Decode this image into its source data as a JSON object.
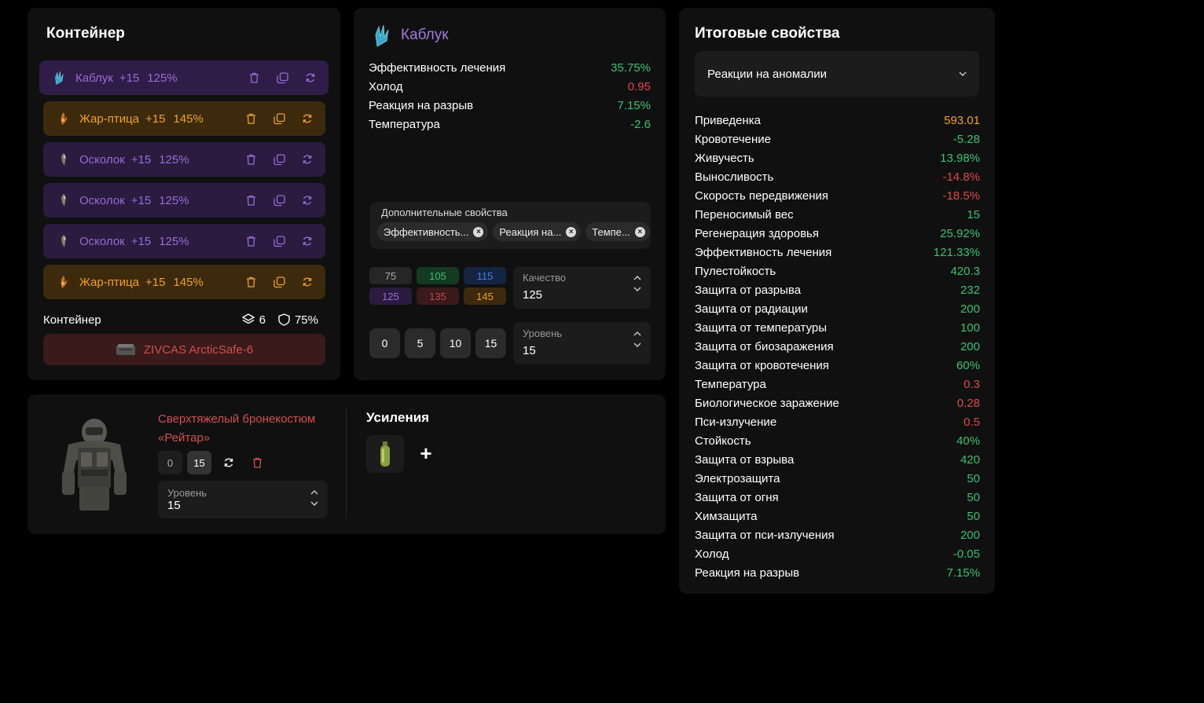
{
  "container": {
    "title": "Контейнер",
    "items": [
      {
        "name": "Каблук",
        "plus": "+15",
        "pct": "125%",
        "tier": "purple",
        "icon": "crystal-icon"
      },
      {
        "name": "Жар-птица",
        "plus": "+15",
        "pct": "145%",
        "tier": "orange",
        "icon": "firebird-icon"
      },
      {
        "name": "Осколок",
        "plus": "+15",
        "pct": "125%",
        "tier": "purple",
        "icon": "shard-icon"
      },
      {
        "name": "Осколок",
        "plus": "+15",
        "pct": "125%",
        "tier": "purple",
        "icon": "shard-icon"
      },
      {
        "name": "Осколок",
        "plus": "+15",
        "pct": "125%",
        "tier": "purple",
        "icon": "shard-icon"
      },
      {
        "name": "Жар-птица",
        "plus": "+15",
        "pct": "145%",
        "tier": "orange",
        "icon": "firebird-icon"
      }
    ],
    "footer_label": "Контейнер",
    "slots": "6",
    "protection": "75%",
    "container_name": "ZIVCAS ArcticSafe-6"
  },
  "artifact": {
    "title": "Каблук",
    "stats": [
      {
        "label": "Эффективность лечения",
        "value": "35.75%",
        "tone": "pos"
      },
      {
        "label": "Холод",
        "value": "0.95",
        "tone": "neg"
      },
      {
        "label": "Реакция на разрыв",
        "value": "7.15%",
        "tone": "pos"
      },
      {
        "label": "Температура",
        "value": "-2.6",
        "tone": "pos"
      }
    ],
    "extra_label": "Дополнительные свойства",
    "chips": [
      "Эффективность...",
      "Реакция на...",
      "Темпе..."
    ],
    "quality_options": [
      "75",
      "105",
      "115",
      "125",
      "135",
      "145"
    ],
    "quality_label": "Качество",
    "quality_value": "125",
    "level_buttons": [
      "0",
      "5",
      "10",
      "15"
    ],
    "level_label": "Уровень",
    "level_value": "15"
  },
  "armor": {
    "name": "Сверхтяжелый бронекостюм «Рейтар»",
    "level_buttons": [
      "0",
      "15"
    ],
    "level_label": "Уровень",
    "level_value": "15",
    "upgrades_title": "Усиления",
    "add_symbol": "+"
  },
  "props": {
    "title": "Итоговые свойства",
    "dropdown": "Реакции на аномалии",
    "rows": [
      {
        "label": "Приведенка",
        "value": "593.01",
        "tone": "gold"
      },
      {
        "label": "Кровотечение",
        "value": "-5.28",
        "tone": "pos"
      },
      {
        "label": "Живучесть",
        "value": "13.98%",
        "tone": "pos"
      },
      {
        "label": "Выносливость",
        "value": "-14.8%",
        "tone": "neg"
      },
      {
        "label": "Скорость передвижения",
        "value": "-18.5%",
        "tone": "neg"
      },
      {
        "label": "Переносимый вес",
        "value": "15",
        "tone": "pos"
      },
      {
        "label": "Регенерация здоровья",
        "value": "25.92%",
        "tone": "pos"
      },
      {
        "label": "Эффективность лечения",
        "value": "121.33%",
        "tone": "pos"
      },
      {
        "label": "Пулестойкость",
        "value": "420.3",
        "tone": "pos"
      },
      {
        "label": "Защита от разрыва",
        "value": "232",
        "tone": "pos"
      },
      {
        "label": "Защита от радиации",
        "value": "200",
        "tone": "pos"
      },
      {
        "label": "Защита от температуры",
        "value": "100",
        "tone": "pos"
      },
      {
        "label": "Защита от биозаражения",
        "value": "200",
        "tone": "pos"
      },
      {
        "label": "Защита от кровотечения",
        "value": "60%",
        "tone": "pos"
      },
      {
        "label": "Температура",
        "value": "0.3",
        "tone": "neg"
      },
      {
        "label": "Биологическое заражение",
        "value": "0.28",
        "tone": "neg"
      },
      {
        "label": "Пси-излучение",
        "value": "0.5",
        "tone": "neg"
      },
      {
        "label": "Стойкость",
        "value": "40%",
        "tone": "pos"
      },
      {
        "label": "Защита от взрыва",
        "value": "420",
        "tone": "pos"
      },
      {
        "label": "Электрозащита",
        "value": "50",
        "tone": "pos"
      },
      {
        "label": "Защита от огня",
        "value": "50",
        "tone": "pos"
      },
      {
        "label": "Химзащита",
        "value": "50",
        "tone": "pos"
      },
      {
        "label": "Защита от пси-излучения",
        "value": "200",
        "tone": "pos"
      },
      {
        "label": "Холод",
        "value": "-0.05",
        "tone": "pos"
      },
      {
        "label": "Реакция на разрыв",
        "value": "7.15%",
        "tone": "pos"
      }
    ]
  },
  "colors": {
    "positive": "#3ac270",
    "negative": "#e04848",
    "gold": "#f0a028",
    "purple": "#9b6ad8"
  }
}
